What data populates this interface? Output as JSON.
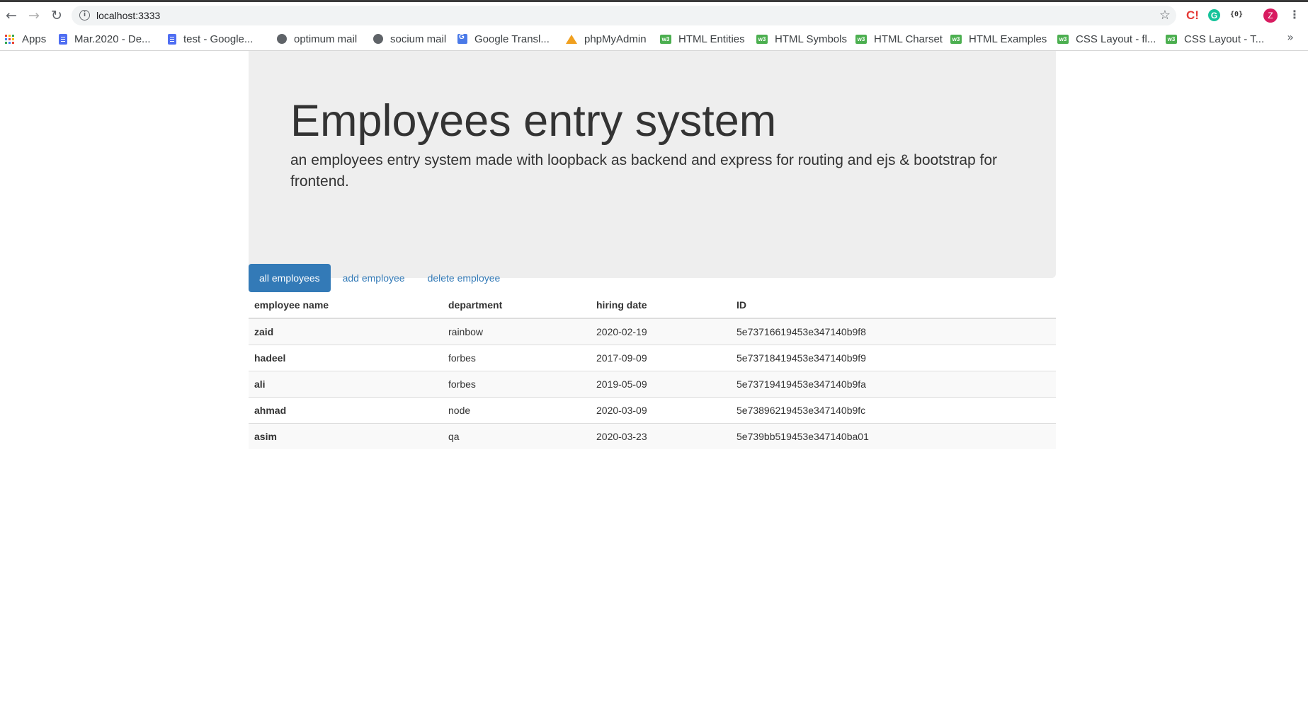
{
  "browser": {
    "url": "localhost:3333",
    "bookmarks": [
      {
        "label": "Apps",
        "icon": "apps-grid-icon"
      },
      {
        "label": "Mar.2020 - De...",
        "icon": "google-docs-icon"
      },
      {
        "label": "test - Google...",
        "icon": "google-docs-icon"
      },
      {
        "label": "optimum mail",
        "icon": "globe-icon"
      },
      {
        "label": "socium mail",
        "icon": "globe-icon"
      },
      {
        "label": "Google Transl...",
        "icon": "google-translate-icon"
      },
      {
        "label": "phpMyAdmin",
        "icon": "phpmyadmin-icon"
      },
      {
        "label": "HTML Entities",
        "icon": "w3schools-icon"
      },
      {
        "label": "HTML Symbols",
        "icon": "w3schools-icon"
      },
      {
        "label": "HTML Charset",
        "icon": "w3schools-icon"
      },
      {
        "label": "HTML Examples",
        "icon": "w3schools-icon"
      },
      {
        "label": "CSS Layout - fl...",
        "icon": "w3schools-icon"
      },
      {
        "label": "CSS Layout - T...",
        "icon": "w3schools-icon"
      }
    ],
    "profile_initial": "Z"
  },
  "header": {
    "title": "Employees entry system",
    "subtitle": "an employees entry system made with loopback as backend and express for routing and ejs & bootstrap for frontend."
  },
  "nav": {
    "tabs": [
      {
        "label": "all employees",
        "active": true
      },
      {
        "label": "add employee",
        "active": false
      },
      {
        "label": "delete employee",
        "active": false
      }
    ]
  },
  "table": {
    "columns": [
      "employee name",
      "department",
      "hiring date",
      "ID"
    ],
    "rows": [
      {
        "name": "zaid",
        "department": "rainbow",
        "hiring_date": "2020-02-19",
        "id": "5e73716619453e347140b9f8"
      },
      {
        "name": "hadeel",
        "department": "forbes",
        "hiring_date": "2017-09-09",
        "id": "5e73718419453e347140b9f9"
      },
      {
        "name": "ali",
        "department": "forbes",
        "hiring_date": "2019-05-09",
        "id": "5e73719419453e347140b9fa"
      },
      {
        "name": "ahmad",
        "department": "node",
        "hiring_date": "2020-03-09",
        "id": "5e73896219453e347140b9fc"
      },
      {
        "name": "asim",
        "department": "qa",
        "hiring_date": "2020-03-23",
        "id": "5e739bb519453e347140ba01"
      }
    ]
  },
  "colors": {
    "primary": "#337ab7",
    "jumbotron_bg": "#eeeeee"
  }
}
